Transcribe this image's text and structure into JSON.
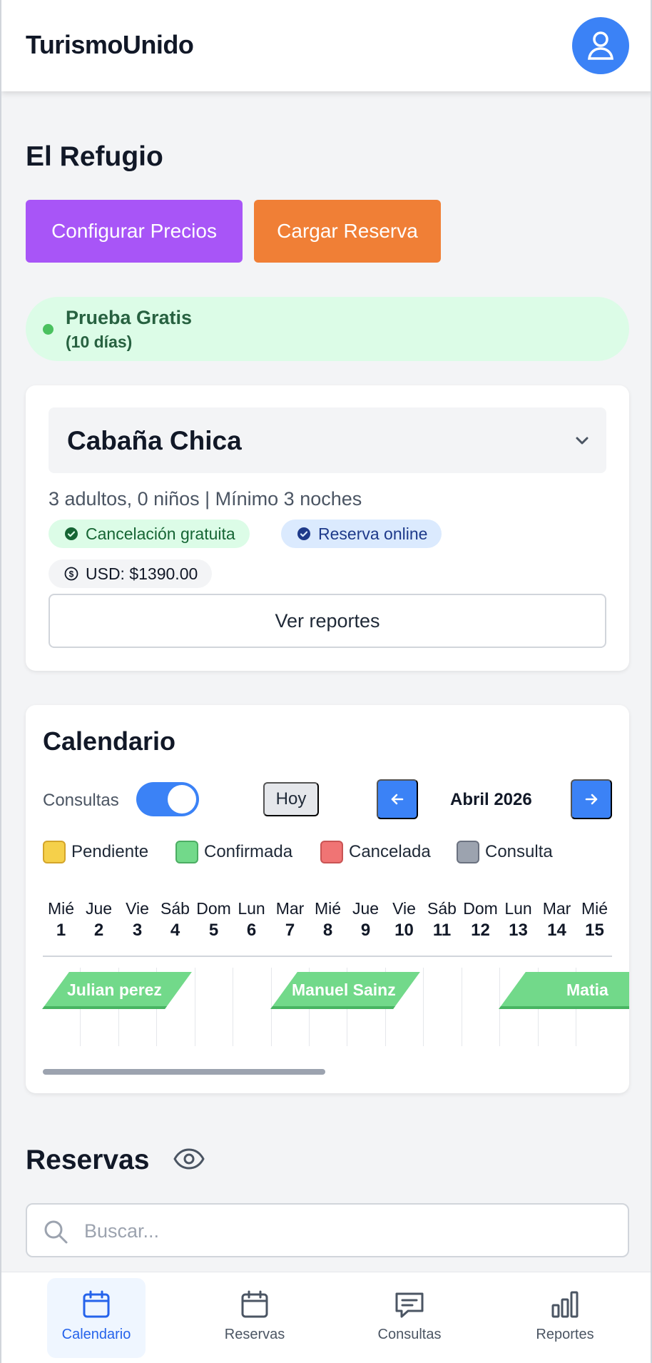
{
  "app": {
    "brand": "TurismoUnido"
  },
  "property": {
    "name": "El Refugio",
    "configure_prices_label": "Configurar Precios",
    "load_booking_label": "Cargar Reserva"
  },
  "trial": {
    "title": "Prueba Gratis",
    "subtitle": "(10 días)",
    "color": "#4ac15f"
  },
  "unit": {
    "selected": "Cabaña Chica",
    "capacity": "3 adultos, 0 niños | Mínimo 3 noches",
    "badges": [
      {
        "label": "Cancelación gratuita",
        "icon": "check-circle-icon"
      },
      {
        "label": "Reserva online",
        "icon": "check-badge-icon"
      },
      {
        "label": "USD: $1390.00",
        "icon": "dollar-circle-icon"
      }
    ],
    "reports_label": "Ver reportes"
  },
  "calendar": {
    "title": "Calendario",
    "consultas_label": "Consultas",
    "consultas_toggle_on": true,
    "today_label": "Hoy",
    "month_label": "Abril 2026",
    "legend": [
      {
        "label": "Pendiente",
        "color": "#f5d04a"
      },
      {
        "label": "Confirmada",
        "color": "#72d98a"
      },
      {
        "label": "Cancelada",
        "color": "#f07474"
      },
      {
        "label": "Consulta",
        "color": "#9ca3af"
      }
    ],
    "days": [
      {
        "name": "Mié",
        "num": "1"
      },
      {
        "name": "Jue",
        "num": "2"
      },
      {
        "name": "Vie",
        "num": "3"
      },
      {
        "name": "Sáb",
        "num": "4"
      },
      {
        "name": "Dom",
        "num": "5"
      },
      {
        "name": "Lun",
        "num": "6"
      },
      {
        "name": "Mar",
        "num": "7"
      },
      {
        "name": "Mié",
        "num": "8"
      },
      {
        "name": "Jue",
        "num": "9"
      },
      {
        "name": "Vie",
        "num": "10"
      },
      {
        "name": "Sáb",
        "num": "11"
      },
      {
        "name": "Dom",
        "num": "12"
      },
      {
        "name": "Lun",
        "num": "13"
      },
      {
        "name": "Mar",
        "num": "14"
      },
      {
        "name": "Mié",
        "num": "15"
      }
    ],
    "bookings": [
      {
        "label": "Julian perez",
        "status": "Confirmada"
      },
      {
        "label": "Manuel Sainz",
        "status": "Confirmada"
      },
      {
        "label": "Matia",
        "status": "Confirmada"
      }
    ]
  },
  "reservas": {
    "title": "Reservas",
    "search_placeholder": "Buscar..."
  },
  "tabs": [
    {
      "label": "Calendario",
      "icon": "calendar-icon",
      "active": true
    },
    {
      "label": "Reservas",
      "icon": "calendar-icon",
      "active": false
    },
    {
      "label": "Consultas",
      "icon": "chat-icon",
      "active": false
    },
    {
      "label": "Reportes",
      "icon": "bar-chart-icon",
      "active": false
    }
  ]
}
